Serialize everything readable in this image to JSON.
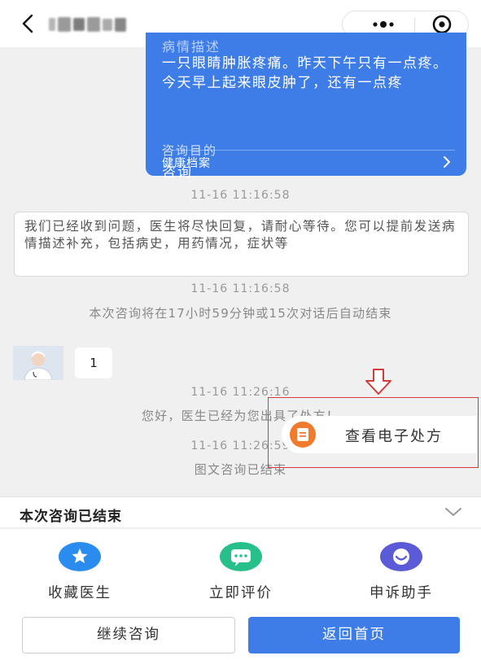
{
  "header": {
    "back_icon": "chevron-left-icon",
    "more_icon": "more-dots-icon",
    "target_icon": "target-icon"
  },
  "consult_card": {
    "section_label_cut": "病情描述",
    "description": "一只眼睛肿胀疼痛。昨天下午只有一点疼。今天早上起来眼皮肿了，还有一点疼",
    "purpose_label": "咨询目的",
    "purpose_value": "咨询",
    "health_record_label": "健康档案"
  },
  "messages": {
    "time1": "11-16 11:16:58",
    "system_reply": "我们已经收到问题，医生将尽快回复，请耐心等待。您可以提前发送病情描述补充，包括病史，用药情况，症状等",
    "time2": "11-16 11:16:58",
    "auto_end_note": "本次咨询将在17小时59分钟或15次对话后自动结束",
    "doctor_message": "1",
    "time3": "11-16 11:26:16",
    "prescription_note": "您好，医生已经为您出具了处方！",
    "time4": "11-16 11:26:59",
    "ended_note": "图文咨询已结束"
  },
  "prescription_button": {
    "label": "查看电子处方",
    "icon": "document-icon",
    "highlight_color": "#d33a3a"
  },
  "bottom": {
    "ended_title": "本次咨询已结束",
    "collapse_icon": "chevron-down-icon",
    "actions": [
      {
        "label": "收藏医生",
        "icon": "star-icon",
        "color": "#2b8cf0"
      },
      {
        "label": "立即评价",
        "icon": "chat-bubble-icon",
        "color": "#27c08a"
      },
      {
        "label": "申诉助手",
        "icon": "smile-icon",
        "color": "#5b5bd8"
      }
    ],
    "continue_label": "继续咨询",
    "home_label": "返回首页"
  },
  "colors": {
    "accent": "#3e7de8",
    "background": "#f0f0f0"
  }
}
